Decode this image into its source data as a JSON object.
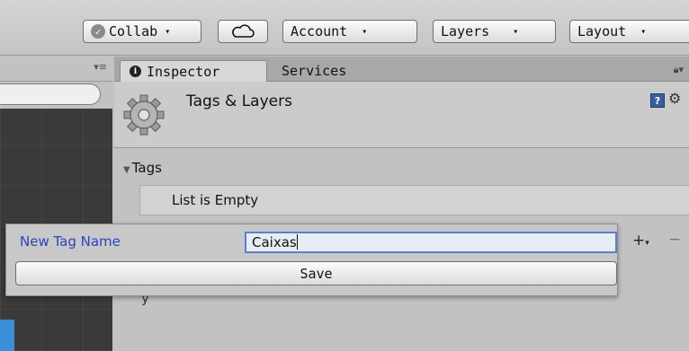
{
  "toolbar": {
    "collab_label": "Collab",
    "account_label": "Account",
    "layers_label": "Layers",
    "layout_label": "Layout"
  },
  "tabs": [
    {
      "label": "Inspector",
      "icon": "info-icon",
      "active": true
    },
    {
      "label": "Services",
      "active": false
    }
  ],
  "inspector": {
    "title": "Tags & Layers",
    "tags_section": "Tags",
    "list_empty": "List is Empty",
    "stray_text": "y"
  },
  "popup": {
    "label": "New Tag Name",
    "value": "Caixas",
    "save_label": "Save"
  },
  "colors": {
    "accent_blue": "#2a44bf",
    "input_border": "#5b7fcf",
    "dark_panel": "#3d3d3d"
  }
}
